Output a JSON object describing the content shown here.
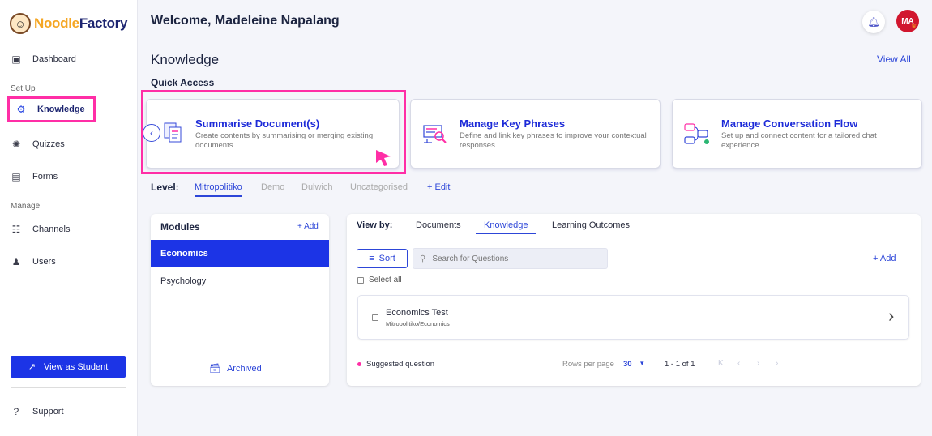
{
  "sidebar": {
    "logo": {
      "part1": "Noodle",
      "part2": "Factory"
    },
    "dashboard": "Dashboard",
    "setup_label": "Set Up",
    "knowledge": "Knowledge",
    "quizzes": "Quizzes",
    "forms": "Forms",
    "manage_label": "Manage",
    "channels": "Channels",
    "users": "Users",
    "view_as_student": "View as Student",
    "support": "Support"
  },
  "header": {
    "welcome": "Welcome, Madeleine Napalang",
    "avatar_initials": "MA"
  },
  "page": {
    "title": "Knowledge",
    "view_all": "View All",
    "quick_access": "Quick Access"
  },
  "cards": [
    {
      "title": "Summarise Document(s)",
      "desc": "Create contents by summarising or merging existing documents"
    },
    {
      "title": "Manage Key Phrases",
      "desc": "Define and link key phrases to improve your contextual responses"
    },
    {
      "title": "Manage Conversation Flow",
      "desc": "Set up and connect content for a tailored chat experience"
    }
  ],
  "level": {
    "label": "Level:",
    "tabs": [
      "Mitropolitiko",
      "Demo",
      "Dulwich",
      "Uncategorised"
    ],
    "edit": "+ Edit"
  },
  "modules": {
    "title": "Modules",
    "add": "+ Add",
    "items": [
      "Economics",
      "Psychology"
    ],
    "archived": "Archived"
  },
  "questions": {
    "view_by": "View by:",
    "tabs": [
      "Documents",
      "Knowledge",
      "Learning Outcomes"
    ],
    "sort": "Sort",
    "search_placeholder": "Search for Questions",
    "add": "+ Add",
    "select_all": "Select all",
    "rows": [
      {
        "title": "Economics Test",
        "path": "Mitropolitiko/Economics"
      }
    ],
    "suggested": "Suggested question",
    "rows_per_page_label": "Rows per page",
    "rows_per_page": "30",
    "range": "1 - 1 of 1"
  },
  "colors": {
    "accent": "#1c34e6",
    "highlight": "#ff2ea6",
    "brand_orange": "#f5a623",
    "brand_navy": "#1c2470"
  }
}
